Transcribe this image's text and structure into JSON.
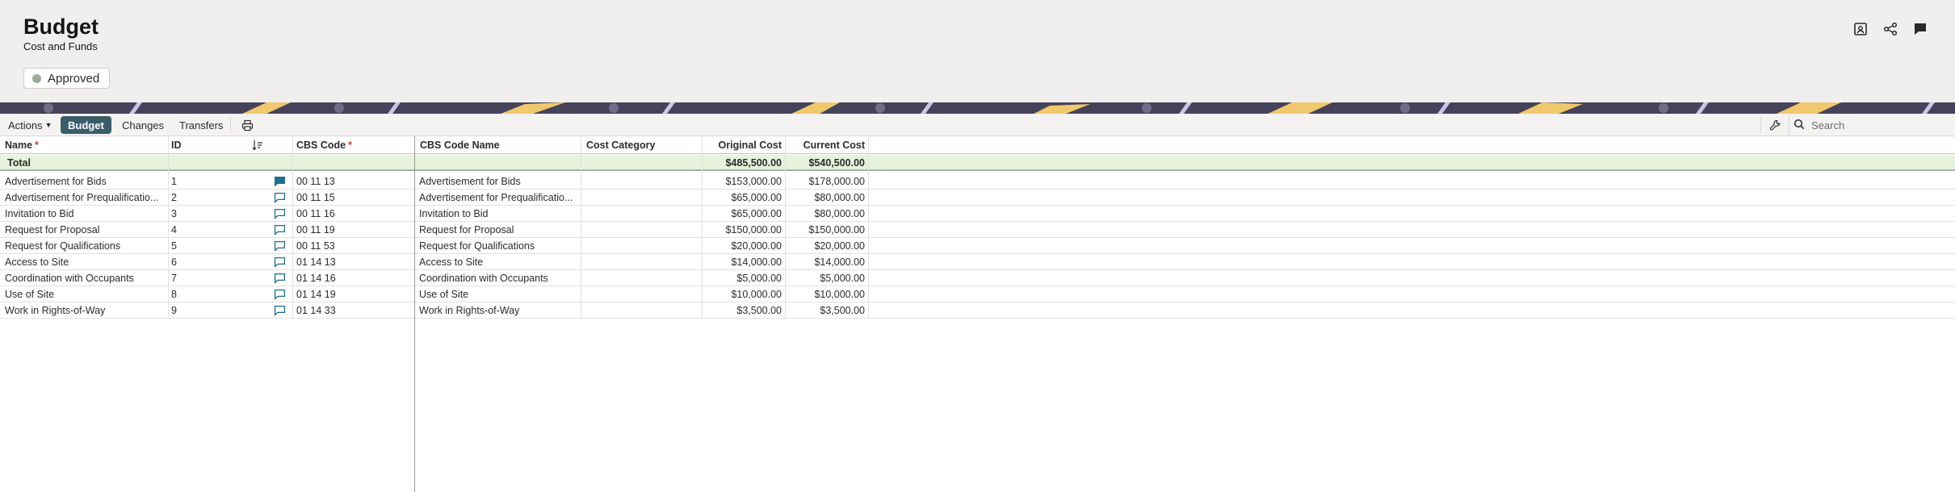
{
  "header": {
    "title": "Budget",
    "subtitle": "Cost and Funds",
    "status": "Approved",
    "icons": [
      "report-icon",
      "share-icon",
      "comment-icon"
    ]
  },
  "toolbar": {
    "actions_label": "Actions",
    "tabs": [
      "Budget",
      "Changes",
      "Transfers"
    ],
    "active_tab": "Budget",
    "search_placeholder": "Search"
  },
  "columns": {
    "name": "Name",
    "id": "ID",
    "cbs_code": "CBS Code",
    "cbs_code_name": "CBS Code Name",
    "cost_category": "Cost Category",
    "original_cost": "Original Cost",
    "current_cost": "Current Cost",
    "required_marker": "*"
  },
  "total": {
    "label": "Total",
    "original_cost": "$485,500.00",
    "current_cost": "$540,500.00"
  },
  "rows": [
    {
      "name": "Advertisement for Bids",
      "id": "1",
      "cbs_code": "00 11 13",
      "cbs_code_name": "Advertisement for Bids",
      "cost_category": "",
      "original_cost": "$153,000.00",
      "current_cost": "$178,000.00",
      "comment_filled": true
    },
    {
      "name": "Advertisement for Prequalificatio...",
      "id": "2",
      "cbs_code": "00 11 15",
      "cbs_code_name": "Advertisement for Prequalificatio...",
      "cost_category": "",
      "original_cost": "$65,000.00",
      "current_cost": "$80,000.00",
      "comment_filled": false
    },
    {
      "name": "Invitation to Bid",
      "id": "3",
      "cbs_code": "00 11 16",
      "cbs_code_name": "Invitation to Bid",
      "cost_category": "",
      "original_cost": "$65,000.00",
      "current_cost": "$80,000.00",
      "comment_filled": false
    },
    {
      "name": "Request for Proposal",
      "id": "4",
      "cbs_code": "00 11 19",
      "cbs_code_name": "Request for Proposal",
      "cost_category": "",
      "original_cost": "$150,000.00",
      "current_cost": "$150,000.00",
      "comment_filled": false
    },
    {
      "name": "Request for Qualifications",
      "id": "5",
      "cbs_code": "00 11 53",
      "cbs_code_name": "Request for Qualifications",
      "cost_category": "",
      "original_cost": "$20,000.00",
      "current_cost": "$20,000.00",
      "comment_filled": false
    },
    {
      "name": "Access to Site",
      "id": "6",
      "cbs_code": "01 14 13",
      "cbs_code_name": "Access to Site",
      "cost_category": "",
      "original_cost": "$14,000.00",
      "current_cost": "$14,000.00",
      "comment_filled": false
    },
    {
      "name": "Coordination with Occupants",
      "id": "7",
      "cbs_code": "01 14 16",
      "cbs_code_name": "Coordination with Occupants",
      "cost_category": "",
      "original_cost": "$5,000.00",
      "current_cost": "$5,000.00",
      "comment_filled": false
    },
    {
      "name": "Use of Site",
      "id": "8",
      "cbs_code": "01 14 19",
      "cbs_code_name": "Use of Site",
      "cost_category": "",
      "original_cost": "$10,000.00",
      "current_cost": "$10,000.00",
      "comment_filled": false
    },
    {
      "name": "Work in Rights-of-Way",
      "id": "9",
      "cbs_code": "01 14 33",
      "cbs_code_name": "Work in Rights-of-Way",
      "cost_category": "",
      "original_cost": "$3,500.00",
      "current_cost": "$3,500.00",
      "comment_filled": false
    }
  ],
  "colors": {
    "header_bg": "#f1efed",
    "accent": "#3b5d69",
    "total_bg": "#e6f2dc",
    "required": "#c74634",
    "comment_icon": "#1e6f8a"
  }
}
